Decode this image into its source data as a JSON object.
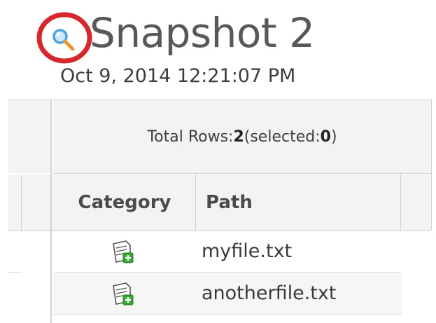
{
  "header": {
    "title": "Snapshot 2",
    "timestamp": "Oct 9, 2014 12:21:07 PM"
  },
  "summary": {
    "prefix": "Total Rows: ",
    "total": "2",
    "selected_prefix": " (selected: ",
    "selected": "0",
    "suffix": ")"
  },
  "table": {
    "columns": [
      "Category",
      "Path"
    ],
    "rows": [
      {
        "category_icon": "add-file-icon",
        "path": "myfile.txt"
      },
      {
        "category_icon": "add-file-icon",
        "path": "anotherfile.txt"
      }
    ]
  },
  "icons": {
    "zoom": "magnifier-icon",
    "highlight": "red-circle-annotation"
  },
  "colors": {
    "highlight_circle": "#d6282c",
    "magnifier_lens": "#4aa3e0",
    "magnifier_handle": "#e89a2e",
    "add_badge": "#36a936"
  }
}
